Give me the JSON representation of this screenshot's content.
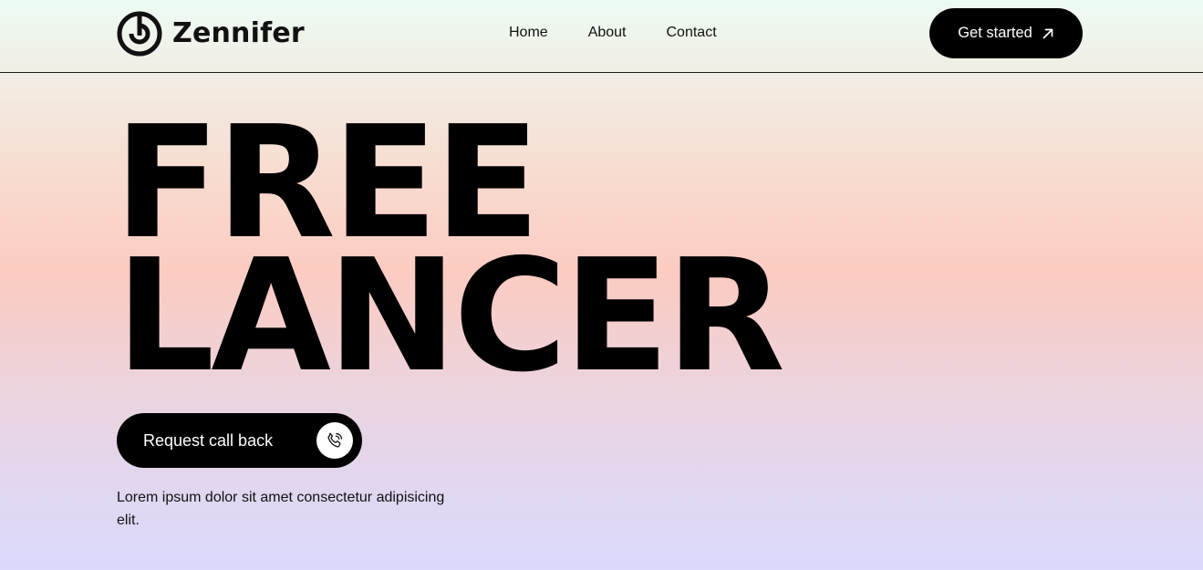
{
  "header": {
    "brand_name": "Zennifer",
    "logo_icon": "concentric-target-logo-icon",
    "nav": [
      {
        "label": "Home"
      },
      {
        "label": "About"
      },
      {
        "label": "Contact"
      }
    ],
    "cta_label": "Get started",
    "cta_icon": "arrow-up-right-icon"
  },
  "hero": {
    "title_line1": "FREE",
    "title_line2": "LANCER",
    "callback_label": "Request call back",
    "callback_icon": "phone-call-icon",
    "description": "Lorem ipsum dolor sit amet consectetur adipisicing elit."
  },
  "colors": {
    "primary": "#000000",
    "gradient_top": "#ecfbf3",
    "gradient_mid": "#fccbc1",
    "gradient_bottom": "#dad8fb"
  }
}
